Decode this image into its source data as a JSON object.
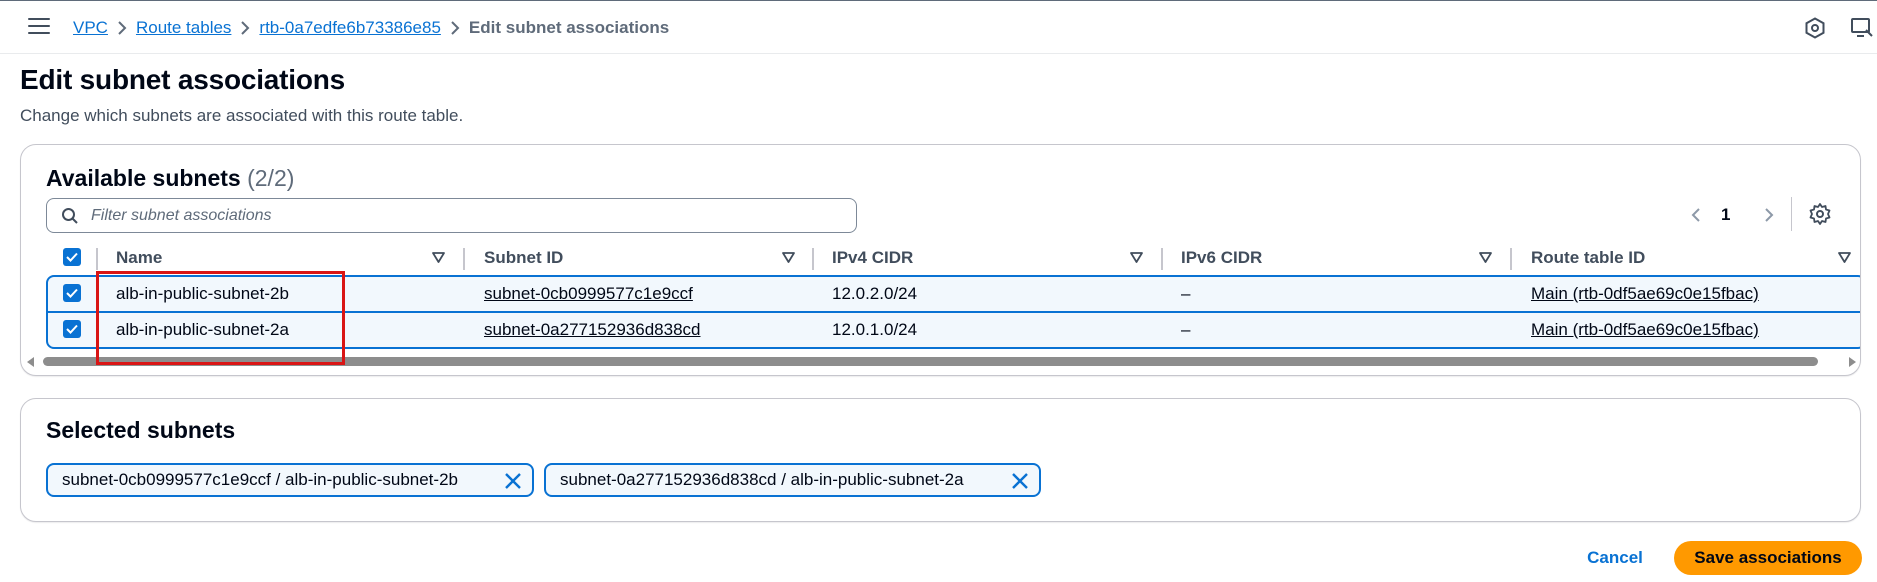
{
  "breadcrumbs": [
    {
      "label": "VPC"
    },
    {
      "label": "Route tables"
    },
    {
      "label": "rtb-0a7edfe6b73386e85"
    },
    {
      "label": "Edit subnet associations"
    }
  ],
  "header": {
    "title": "Edit subnet associations",
    "description": "Change which subnets are associated with this route table."
  },
  "available": {
    "title": "Available subnets",
    "count": "(2/2)",
    "filter_placeholder": "Filter subnet associations",
    "page": "1",
    "columns": [
      "Name",
      "Subnet ID",
      "IPv4 CIDR",
      "IPv6 CIDR",
      "Route table ID"
    ],
    "rows": [
      {
        "name": "alb-in-public-subnet-2b",
        "subnet_id": "subnet-0cb0999577c1e9ccf",
        "ipv4": "12.0.2.0/24",
        "ipv6": "–",
        "route_table": "Main (rtb-0df5ae69c0e15fbac)"
      },
      {
        "name": "alb-in-public-subnet-2a",
        "subnet_id": "subnet-0a277152936d838cd",
        "ipv4": "12.0.1.0/24",
        "ipv6": "–",
        "route_table": "Main (rtb-0df5ae69c0e15fbac)"
      }
    ]
  },
  "selected": {
    "title": "Selected subnets",
    "tokens": [
      {
        "label": "subnet-0cb0999577c1e9ccf / alb-in-public-subnet-2b"
      },
      {
        "label": "subnet-0a277152936d838cd / alb-in-public-subnet-2a"
      }
    ]
  },
  "actions": {
    "cancel": "Cancel",
    "save": "Save associations"
  },
  "colors": {
    "link": "#0972d3",
    "primary_button": "#ff9900",
    "selected_row_bg": "#f2f8fd",
    "annotation_box": "#d91515"
  },
  "icons": {
    "menu": "hamburger-menu-icon",
    "help": "help-hexagon-icon",
    "feedback": "feedback-screen-icon",
    "search": "search-icon",
    "prev": "chevron-left-icon",
    "next": "chevron-right-icon",
    "settings": "gear-icon",
    "sort": "sort-caret-down-icon",
    "remove": "close-icon"
  }
}
